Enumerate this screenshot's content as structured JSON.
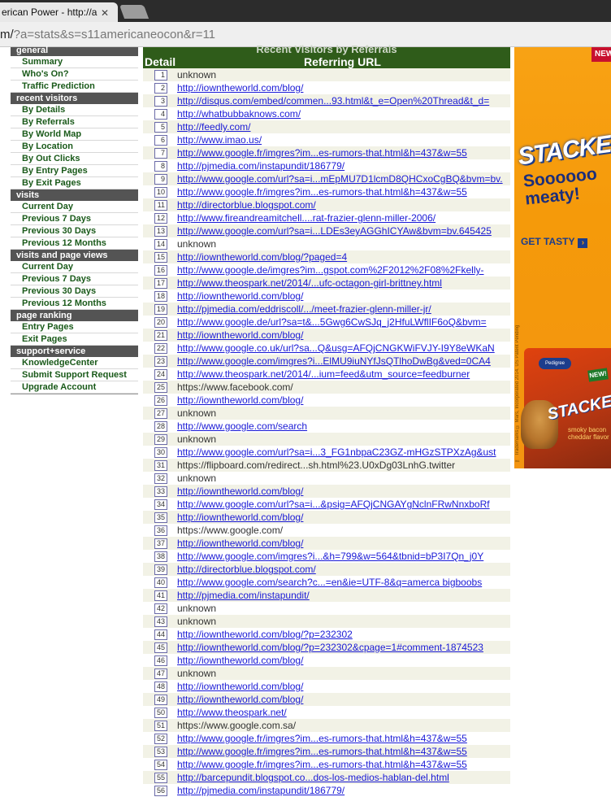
{
  "browser": {
    "tab_title": "erican Power - http://a",
    "tab_close": "✕",
    "url_visible_prefix": "m/",
    "url_rest": "?a=stats&s=s11americaneocon&r=11"
  },
  "sidebar": {
    "sections": [
      {
        "title": "general",
        "items": [
          "Summary",
          "Who's On?",
          "Traffic Prediction"
        ]
      },
      {
        "title": "recent visitors",
        "items": [
          "By Details",
          "By Referrals",
          "By World Map",
          "By Location",
          "By Out Clicks",
          "By Entry Pages",
          "By Exit Pages"
        ]
      },
      {
        "title": "visits",
        "items": [
          "Current Day",
          "Previous 7 Days",
          "Previous 30 Days",
          "Previous 12 Months"
        ]
      },
      {
        "title": "visits and page views",
        "items": [
          "Current Day",
          "Previous 7 Days",
          "Previous 30 Days",
          "Previous 12 Months"
        ]
      },
      {
        "title": "page ranking",
        "items": [
          "Entry Pages",
          "Exit Pages"
        ]
      },
      {
        "title": "support+service",
        "items": [
          "KnowledgeCenter",
          "Submit Support Request",
          "Upgrade Account"
        ]
      }
    ]
  },
  "table": {
    "title": "Recent Visitors by Referrals",
    "col_detail": "Detail",
    "col_ref": "Referring URL",
    "rows": [
      {
        "n": "1",
        "url": "unknown",
        "link": false
      },
      {
        "n": "2",
        "url": "http://iowntheworld.com/blog/",
        "link": true
      },
      {
        "n": "3",
        "url": "http://disqus.com/embed/commen...93.html&t_e=Open%20Thread&t_d=",
        "link": true
      },
      {
        "n": "4",
        "url": "http://whatbubbaknows.com/",
        "link": true
      },
      {
        "n": "5",
        "url": "http://feedly.com/",
        "link": true
      },
      {
        "n": "6",
        "url": "http://www.imao.us/",
        "link": true
      },
      {
        "n": "7",
        "url": "http://www.google.fr/imgres?im...es-rumors-that.html&h=437&w=55",
        "link": true
      },
      {
        "n": "8",
        "url": "http://pjmedia.com/instapundit/186779/",
        "link": true
      },
      {
        "n": "9",
        "url": "http://www.google.com/url?sa=i...mEpMU7D1lcmD8QHCxoCgBQ&bvm=bv.",
        "link": true
      },
      {
        "n": "10",
        "url": "http://www.google.fr/imgres?im...es-rumors-that.html&h=437&w=55",
        "link": true
      },
      {
        "n": "11",
        "url": "http://directorblue.blogspot.com/",
        "link": true
      },
      {
        "n": "12",
        "url": "http://www.fireandreamitchell....rat-frazier-glenn-miller-2006/",
        "link": true
      },
      {
        "n": "13",
        "url": "http://www.google.com/url?sa=i...LDEs3eyAGGhICYAw&bvm=bv.645425",
        "link": true
      },
      {
        "n": "14",
        "url": "unknown",
        "link": false
      },
      {
        "n": "15",
        "url": "http://iowntheworld.com/blog/?paged=4",
        "link": true
      },
      {
        "n": "16",
        "url": "http://www.google.de/imgres?im...gspot.com%2F2012%2F08%2Fkelly-",
        "link": true
      },
      {
        "n": "17",
        "url": "http://www.theospark.net/2014/...ufc-octagon-girl-brittney.html",
        "link": true
      },
      {
        "n": "18",
        "url": "http://iowntheworld.com/blog/",
        "link": true
      },
      {
        "n": "19",
        "url": "http://pjmedia.com/eddriscoll/.../meet-frazier-glenn-miller-jr/",
        "link": true
      },
      {
        "n": "20",
        "url": "http://www.google.de/url?sa=t&...5Gwg6CwSJq_j2HfuLWflIF6oQ&bvm=",
        "link": true
      },
      {
        "n": "21",
        "url": "http://iowntheworld.com/blog/",
        "link": true
      },
      {
        "n": "22",
        "url": "http://www.google.co.uk/url?sa...Q&usg=AFQjCNGKWiFVJY-I9Y8eWKaN",
        "link": true
      },
      {
        "n": "23",
        "url": "http://www.google.com/imgres?i...ElMU9iuNYfJsQTlhoDwBg&ved=0CA4",
        "link": true
      },
      {
        "n": "24",
        "url": "http://www.theospark.net/2014/...ium=feed&utm_source=feedburner",
        "link": true
      },
      {
        "n": "25",
        "url": "https://www.facebook.com/",
        "link": false
      },
      {
        "n": "26",
        "url": "http://iowntheworld.com/blog/",
        "link": true
      },
      {
        "n": "27",
        "url": "unknown",
        "link": false
      },
      {
        "n": "28",
        "url": "http://www.google.com/search",
        "link": true
      },
      {
        "n": "29",
        "url": "unknown",
        "link": false
      },
      {
        "n": "30",
        "url": "http://www.google.com/url?sa=i...3_FG1nbpaC23GZ-mHGzSTPXzAg&ust",
        "link": true
      },
      {
        "n": "31",
        "url": "https://flipboard.com/redirect...sh.html%23.U0xDg03LnhG.twitter",
        "link": false
      },
      {
        "n": "32",
        "url": "unknown",
        "link": false
      },
      {
        "n": "33",
        "url": "http://iowntheworld.com/blog/",
        "link": true
      },
      {
        "n": "34",
        "url": "http://www.google.com/url?sa=i...&psig=AFQjCNGAYgNclnFRwNnxboRf",
        "link": true
      },
      {
        "n": "35",
        "url": "http://iowntheworld.com/blog/",
        "link": true
      },
      {
        "n": "36",
        "url": "https://www.google.com/",
        "link": false
      },
      {
        "n": "37",
        "url": "http://iowntheworld.com/blog/",
        "link": true
      },
      {
        "n": "38",
        "url": "http://www.google.com/imgres?i...&h=799&w=564&tbnid=bP3I7Qn_j0Y",
        "link": true
      },
      {
        "n": "39",
        "url": "http://directorblue.blogspot.com/",
        "link": true
      },
      {
        "n": "40",
        "url": "http://www.google.com/search?c...=en&ie=UTF-8&q=amerca bigboobs",
        "link": true
      },
      {
        "n": "41",
        "url": "http://pjmedia.com/instapundit/",
        "link": true
      },
      {
        "n": "42",
        "url": "unknown",
        "link": false
      },
      {
        "n": "43",
        "url": "unknown",
        "link": false
      },
      {
        "n": "44",
        "url": "http://iowntheworld.com/blog/?p=232302",
        "link": true
      },
      {
        "n": "45",
        "url": "http://iowntheworld.com/blog/?p=232302&cpage=1#comment-1874523",
        "link": true
      },
      {
        "n": "46",
        "url": "http://iowntheworld.com/blog/",
        "link": true
      },
      {
        "n": "47",
        "url": "unknown",
        "link": false
      },
      {
        "n": "48",
        "url": "http://iowntheworld.com/blog/",
        "link": true
      },
      {
        "n": "49",
        "url": "http://iowntheworld.com/blog/",
        "link": true
      },
      {
        "n": "50",
        "url": "http://www.theospark.net/",
        "link": true
      },
      {
        "n": "51",
        "url": "https://www.google.com.sa/",
        "link": false
      },
      {
        "n": "52",
        "url": "http://www.google.fr/imgres?im...es-rumors-that.html&h=437&w=55",
        "link": true
      },
      {
        "n": "53",
        "url": "http://www.google.fr/imgres?im...es-rumors-that.html&h=437&w=55",
        "link": true
      },
      {
        "n": "54",
        "url": "http://www.google.fr/imgres?im...es-rumors-that.html&h=437&w=55",
        "link": true
      },
      {
        "n": "55",
        "url": "http://barcepundit.blogspot.co...dos-los-medios-hablan-del.html",
        "link": true
      },
      {
        "n": "56",
        "url": "http://pjmedia.com/instapundit/186779/",
        "link": true
      }
    ]
  },
  "ad": {
    "new_badge": "NEW",
    "brand": "STACKERZ",
    "tagline_1": "Soooooo",
    "tagline_2": "meaty!",
    "cta": "GET TASTY",
    "cta_arrow": "›",
    "legal": "™ Trademarks © Mars, Incorporated 2014. US Patent Pending",
    "pack_logo": "Pedigree",
    "pack_new": "NEW!",
    "pack_brand": "STACKERZ",
    "pack_sub_1": "smoky bacon",
    "pack_sub_2": "cheddar flavor"
  }
}
